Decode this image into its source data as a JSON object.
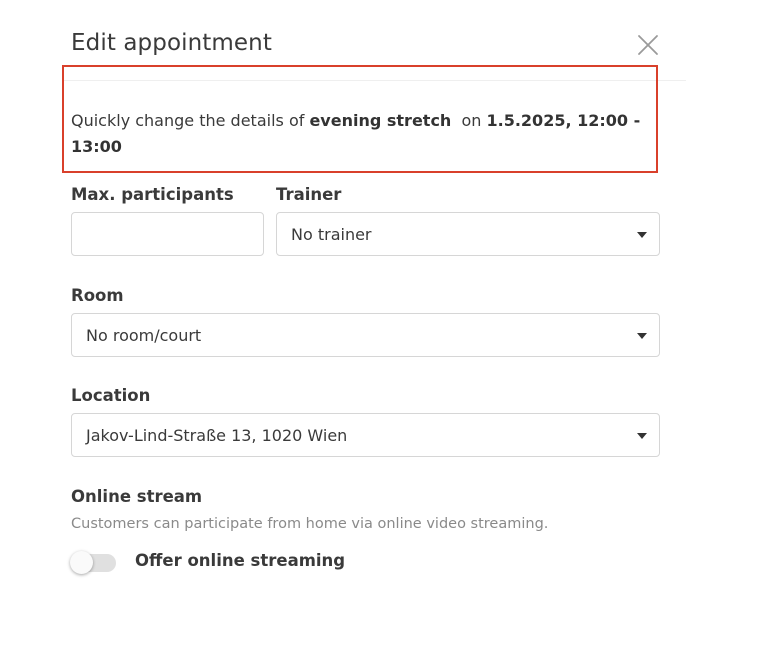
{
  "dialog": {
    "title": "Edit appointment"
  },
  "intro": {
    "prefix": "Quickly change the details of ",
    "course_name": "evening stretch",
    "middle": "  on ",
    "datetime": "1.5.2025, 12:00 - 13:00"
  },
  "fields": {
    "max_participants": {
      "label": "Max. participants",
      "value": "",
      "placeholder": ""
    },
    "trainer": {
      "label": "Trainer",
      "value": "No trainer"
    },
    "room": {
      "label": "Room",
      "value": "No room/court"
    },
    "location": {
      "label": "Location",
      "value": "Jakov-Lind-Straße 13, 1020 Wien"
    }
  },
  "online_stream": {
    "label": "Online stream",
    "hint": "Customers can participate from home via online video streaming.",
    "toggle_label": "Offer online streaming",
    "enabled": false
  },
  "colors": {
    "highlight_border": "#d9402b",
    "text": "#3a3a3a",
    "muted": "#8a8a8a",
    "border": "#d6d6d6"
  },
  "icons": {
    "close": "close-icon",
    "dropdown": "chevron-down-icon"
  }
}
